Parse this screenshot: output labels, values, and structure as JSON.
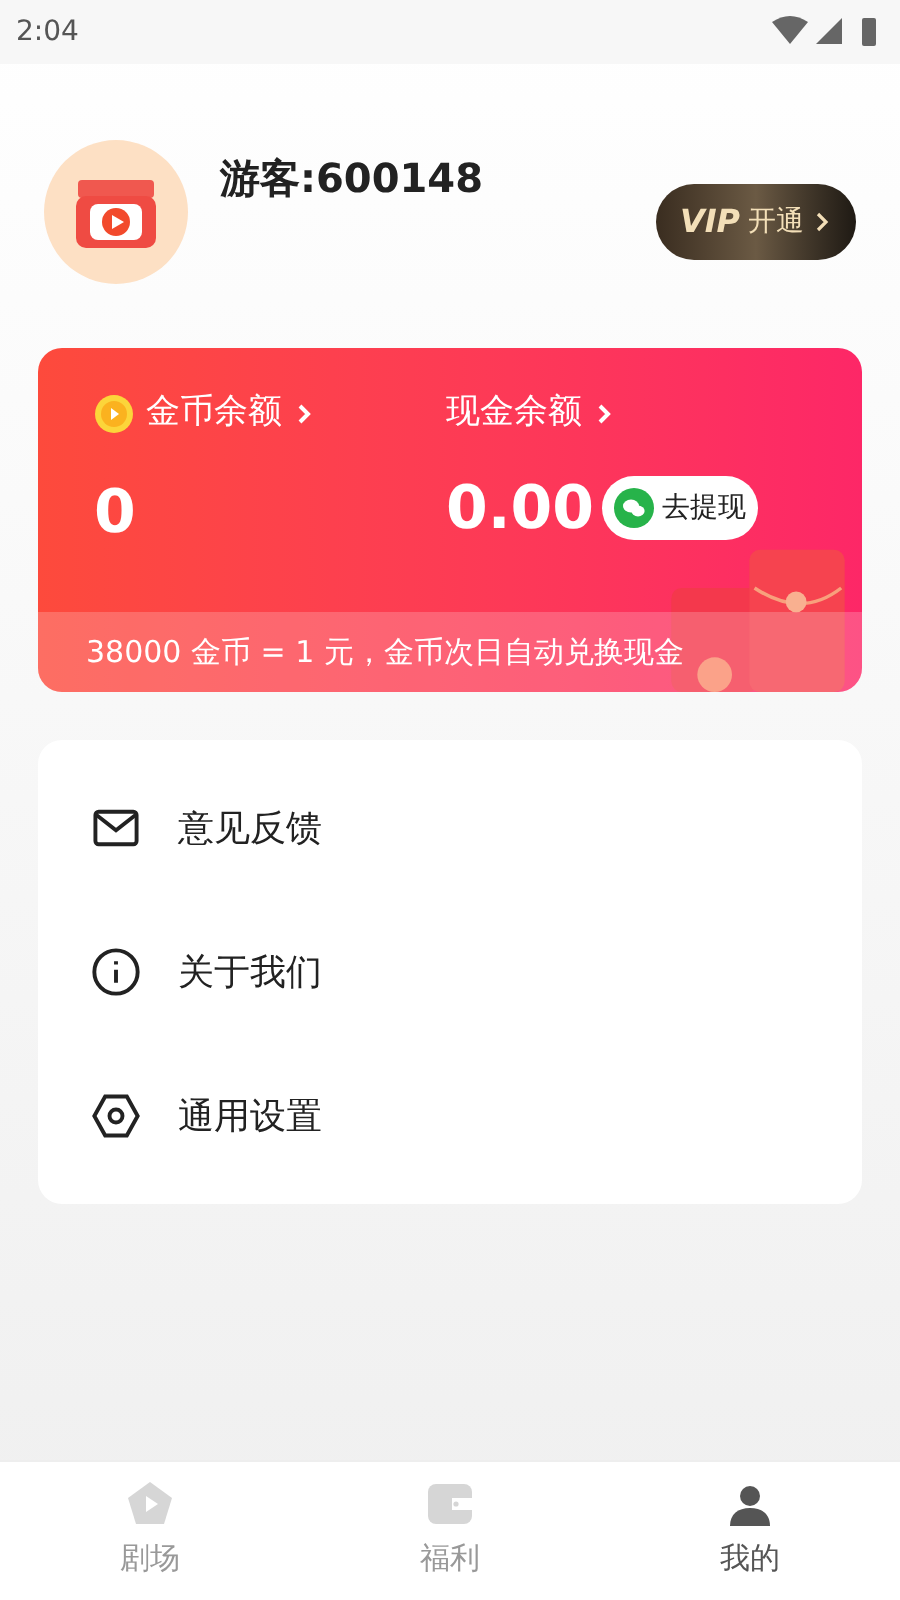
{
  "status_bar": {
    "time": "2:04"
  },
  "profile": {
    "name": "游客:600148",
    "vip_button": {
      "badge": "VIP",
      "label": "开通"
    }
  },
  "balance_card": {
    "coins": {
      "label": "金币余额",
      "value": "0"
    },
    "cash": {
      "label": "现金余额",
      "value": "0.00",
      "withdraw_button": "去提现"
    },
    "note": "38000 金币 = 1 元，金币次日自动兑换现金"
  },
  "menu": [
    {
      "kind": "mail",
      "label": "意见反馈"
    },
    {
      "kind": "info",
      "label": "关于我们"
    },
    {
      "kind": "settings",
      "label": "通用设置"
    }
  ],
  "tabs": [
    {
      "kind": "theater",
      "label": "剧场",
      "selected": false
    },
    {
      "kind": "wallet",
      "label": "福利",
      "selected": false
    },
    {
      "kind": "user",
      "label": "我的",
      "selected": true
    }
  ]
}
